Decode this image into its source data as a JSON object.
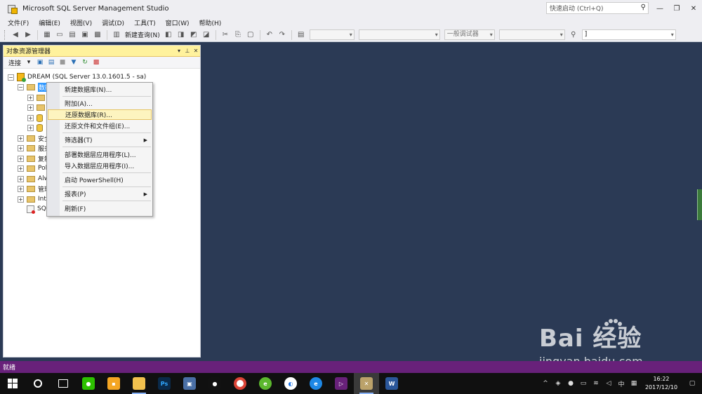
{
  "window": {
    "title": "Microsoft SQL Server Management Studio",
    "quick_launch_placeholder": "快速启动 (Ctrl+Q)"
  },
  "menubar": [
    "文件(F)",
    "编辑(E)",
    "视图(V)",
    "调试(D)",
    "工具(T)",
    "窗口(W)",
    "帮助(H)"
  ],
  "toolbar": {
    "new_query": "新建查询(N)",
    "debugger_combo": "一般调试器",
    "right_combo_value": "]"
  },
  "object_explorer": {
    "title": "对象资源管理器",
    "connect": "连接",
    "server": "DREAM (SQL Server 13.0.1601.5 - sa)",
    "nodes": {
      "databases": "数据",
      "security": "安全",
      "server_objects": "服务",
      "replication": "复制",
      "polybase": "Pol",
      "always_on": "Alw",
      "management": "管理",
      "integration": "Inte",
      "sql_agent": "SQL"
    }
  },
  "context_menu": {
    "items": [
      "新建数据库(N)...",
      "附加(A)...",
      "还原数据库(R)...",
      "还原文件和文件组(E)...",
      "筛选器(T)",
      "部署数据层应用程序(L)...",
      "导入数据层应用程序(I)...",
      "启动 PowerShell(H)",
      "报表(P)",
      "刷新(F)"
    ],
    "highlighted_index": 2
  },
  "statusbar": {
    "text": "就绪"
  },
  "taskbar": {
    "clock_time": "16:22",
    "clock_date": "2017/12/10",
    "ime": "中"
  },
  "watermark": {
    "logo": "Bai  经验",
    "url": "jingyan.baidu.com"
  },
  "colors": {
    "workspace": "#2b3a55",
    "statusbar": "#68217a",
    "menu_highlight": "#fdf4bf",
    "panel_header": "#fff29d"
  }
}
